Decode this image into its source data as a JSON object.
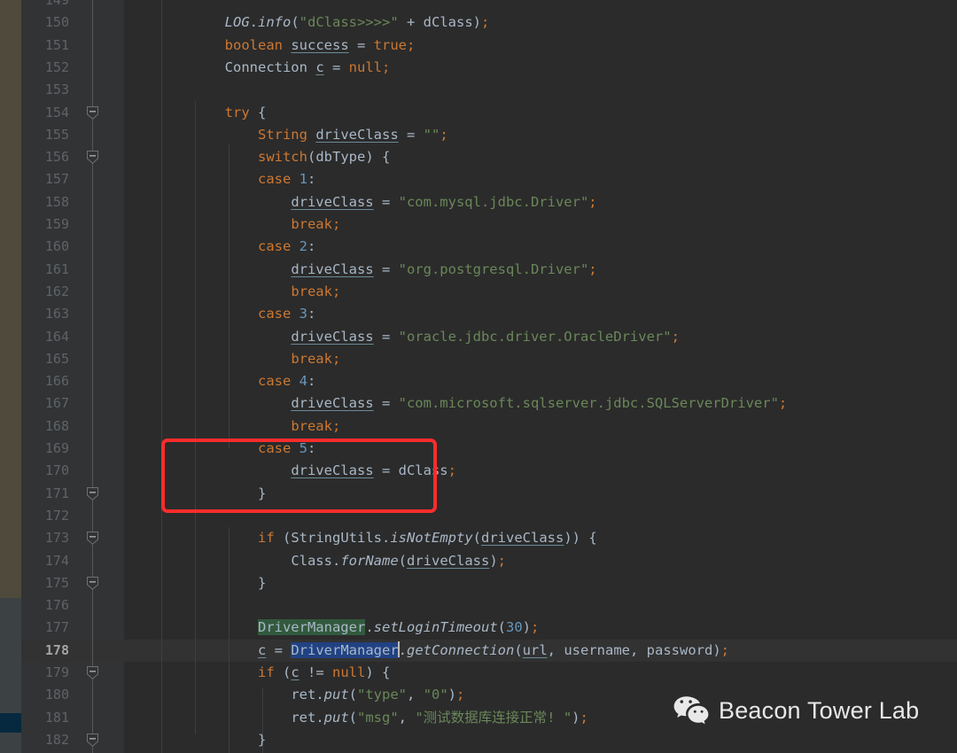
{
  "editor": {
    "app": "java-code-editor",
    "theme": "darcula",
    "background": "#2b2b2b",
    "gutter_background": "#313335",
    "current_line": 178,
    "first_visible_line": 149,
    "last_visible_line": 182,
    "selection": {
      "text": "DriverManager",
      "line": 178,
      "color": "#214283"
    },
    "search_highlight": {
      "text": "DriverManager",
      "line": 177,
      "color": "#32593d"
    },
    "lines": [
      {
        "n": 149,
        "text": "",
        "fold": "",
        "partial": true
      },
      {
        "n": 150,
        "text": "        LOG.info(\"dClass>>>>\" + dClass);",
        "fold": ""
      },
      {
        "n": 151,
        "text": "        boolean success = true;",
        "fold": ""
      },
      {
        "n": 152,
        "text": "        Connection c = null;",
        "fold": ""
      },
      {
        "n": 153,
        "text": "",
        "fold": ""
      },
      {
        "n": 154,
        "text": "        try {",
        "fold": "minus"
      },
      {
        "n": 155,
        "text": "            String driveClass = \"\";",
        "fold": ""
      },
      {
        "n": 156,
        "text": "            switch(dbType) {",
        "fold": "minus"
      },
      {
        "n": 157,
        "text": "            case 1:",
        "fold": ""
      },
      {
        "n": 158,
        "text": "                driveClass = \"com.mysql.jdbc.Driver\";",
        "fold": ""
      },
      {
        "n": 159,
        "text": "                break;",
        "fold": ""
      },
      {
        "n": 160,
        "text": "            case 2:",
        "fold": ""
      },
      {
        "n": 161,
        "text": "                driveClass = \"org.postgresql.Driver\";",
        "fold": ""
      },
      {
        "n": 162,
        "text": "                break;",
        "fold": ""
      },
      {
        "n": 163,
        "text": "            case 3:",
        "fold": ""
      },
      {
        "n": 164,
        "text": "                driveClass = \"oracle.jdbc.driver.OracleDriver\";",
        "fold": ""
      },
      {
        "n": 165,
        "text": "                break;",
        "fold": ""
      },
      {
        "n": 166,
        "text": "            case 4:",
        "fold": ""
      },
      {
        "n": 167,
        "text": "                driveClass = \"com.microsoft.sqlserver.jdbc.SQLServerDriver\";",
        "fold": ""
      },
      {
        "n": 168,
        "text": "                break;",
        "fold": ""
      },
      {
        "n": 169,
        "text": "            case 5:",
        "fold": ""
      },
      {
        "n": 170,
        "text": "                driveClass = dClass;",
        "fold": ""
      },
      {
        "n": 171,
        "text": "            }",
        "fold": "minus"
      },
      {
        "n": 172,
        "text": "",
        "fold": ""
      },
      {
        "n": 173,
        "text": "            if (StringUtils.isNotEmpty(driveClass)) {",
        "fold": "minus"
      },
      {
        "n": 174,
        "text": "                Class.forName(driveClass);",
        "fold": ""
      },
      {
        "n": 175,
        "text": "            }",
        "fold": "minus"
      },
      {
        "n": 176,
        "text": "",
        "fold": ""
      },
      {
        "n": 177,
        "text": "            DriverManager.setLoginTimeout(30);",
        "fold": ""
      },
      {
        "n": 178,
        "text": "            c = DriverManager.getConnection(url, username, password);",
        "fold": ""
      },
      {
        "n": 179,
        "text": "            if (c != null) {",
        "fold": "minus"
      },
      {
        "n": 180,
        "text": "                ret.put(\"type\", \"0\");",
        "fold": ""
      },
      {
        "n": 181,
        "text": "                ret.put(\"msg\", \"测试数据库连接正常! \");",
        "fold": ""
      },
      {
        "n": 182,
        "text": "            }",
        "fold": "minus"
      }
    ],
    "vcs_bands": [
      {
        "color": "#4f4a3c",
        "label": "modified-lines-band"
      },
      {
        "color": "#3c4244",
        "label": "unchanged-band"
      },
      {
        "color": "#06293f",
        "label": "added-lines-band"
      },
      {
        "color": "#3c4244",
        "label": "unchanged-band-lower"
      }
    ]
  },
  "annotation": {
    "redbox_label": "highlighted-code-region",
    "color": "#fb2c2c",
    "covers_lines": "169-171"
  },
  "watermark": {
    "text": "Beacon Tower Lab",
    "icon": "wechat-icon",
    "color": "#e8e8e8"
  }
}
